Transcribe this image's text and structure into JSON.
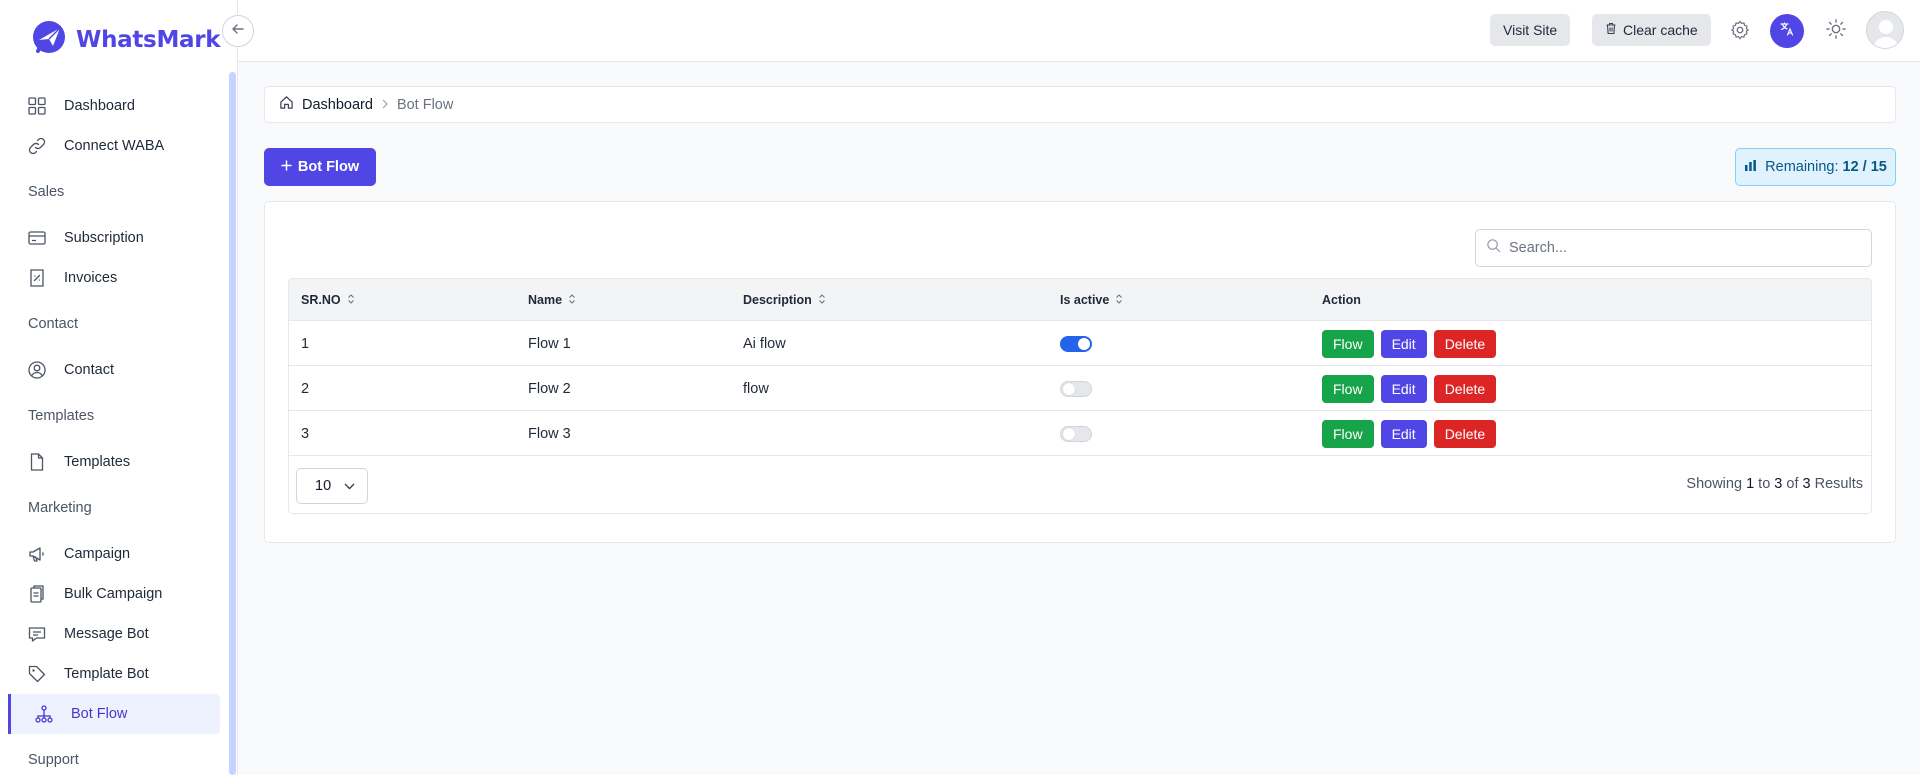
{
  "app": {
    "name": "WhatsMark"
  },
  "sidebar": {
    "nav": [
      {
        "type": "item",
        "label": "Dashboard",
        "icon": "dashboard-icon"
      },
      {
        "type": "item",
        "label": "Connect WABA",
        "icon": "link-icon"
      },
      {
        "type": "section",
        "label": "Sales"
      },
      {
        "type": "item",
        "label": "Subscription",
        "icon": "credit-card-icon"
      },
      {
        "type": "item",
        "label": "Invoices",
        "icon": "invoice-icon"
      },
      {
        "type": "section",
        "label": "Contact"
      },
      {
        "type": "item",
        "label": "Contact",
        "icon": "user-circle-icon"
      },
      {
        "type": "section",
        "label": "Templates"
      },
      {
        "type": "item",
        "label": "Templates",
        "icon": "document-icon"
      },
      {
        "type": "section",
        "label": "Marketing"
      },
      {
        "type": "item",
        "label": "Campaign",
        "icon": "megaphone-icon"
      },
      {
        "type": "item",
        "label": "Bulk Campaign",
        "icon": "clipboard-copy-icon"
      },
      {
        "type": "item",
        "label": "Message Bot",
        "icon": "chat-icon"
      },
      {
        "type": "item",
        "label": "Template Bot",
        "icon": "tag-icon"
      },
      {
        "type": "item",
        "label": "Bot Flow",
        "icon": "flow-tree-icon",
        "active": true
      },
      {
        "type": "section",
        "label": "Support"
      }
    ]
  },
  "topbar": {
    "visit_site": "Visit Site",
    "clear_cache": "Clear cache"
  },
  "breadcrumb": {
    "home": "Dashboard",
    "current": "Bot Flow"
  },
  "page": {
    "add_button": "Bot Flow",
    "remaining_label": "Remaining:",
    "remaining_value": "12 / 15",
    "search_placeholder": "Search..."
  },
  "table": {
    "headers": {
      "srno": "SR.NO",
      "name": "Name",
      "description": "Description",
      "is_active": "Is active",
      "action": "Action"
    },
    "actions": {
      "flow": "Flow",
      "edit": "Edit",
      "delete": "Delete"
    },
    "rows": [
      {
        "srno": "1",
        "name": "Flow 1",
        "description": "Ai flow",
        "active": true
      },
      {
        "srno": "2",
        "name": "Flow 2",
        "description": "flow",
        "active": false
      },
      {
        "srno": "3",
        "name": "Flow 3",
        "description": "",
        "active": false
      }
    ],
    "per_page": "10",
    "showing": {
      "prefix": "Showing",
      "from": "1",
      "to_word": "to",
      "to": "3",
      "of_word": "of",
      "total": "3",
      "suffix": "Results"
    }
  },
  "colors": {
    "primary": "#4f46e5",
    "success": "#16a34a",
    "danger": "#dc2626",
    "toggle_on": "#2563eb"
  }
}
